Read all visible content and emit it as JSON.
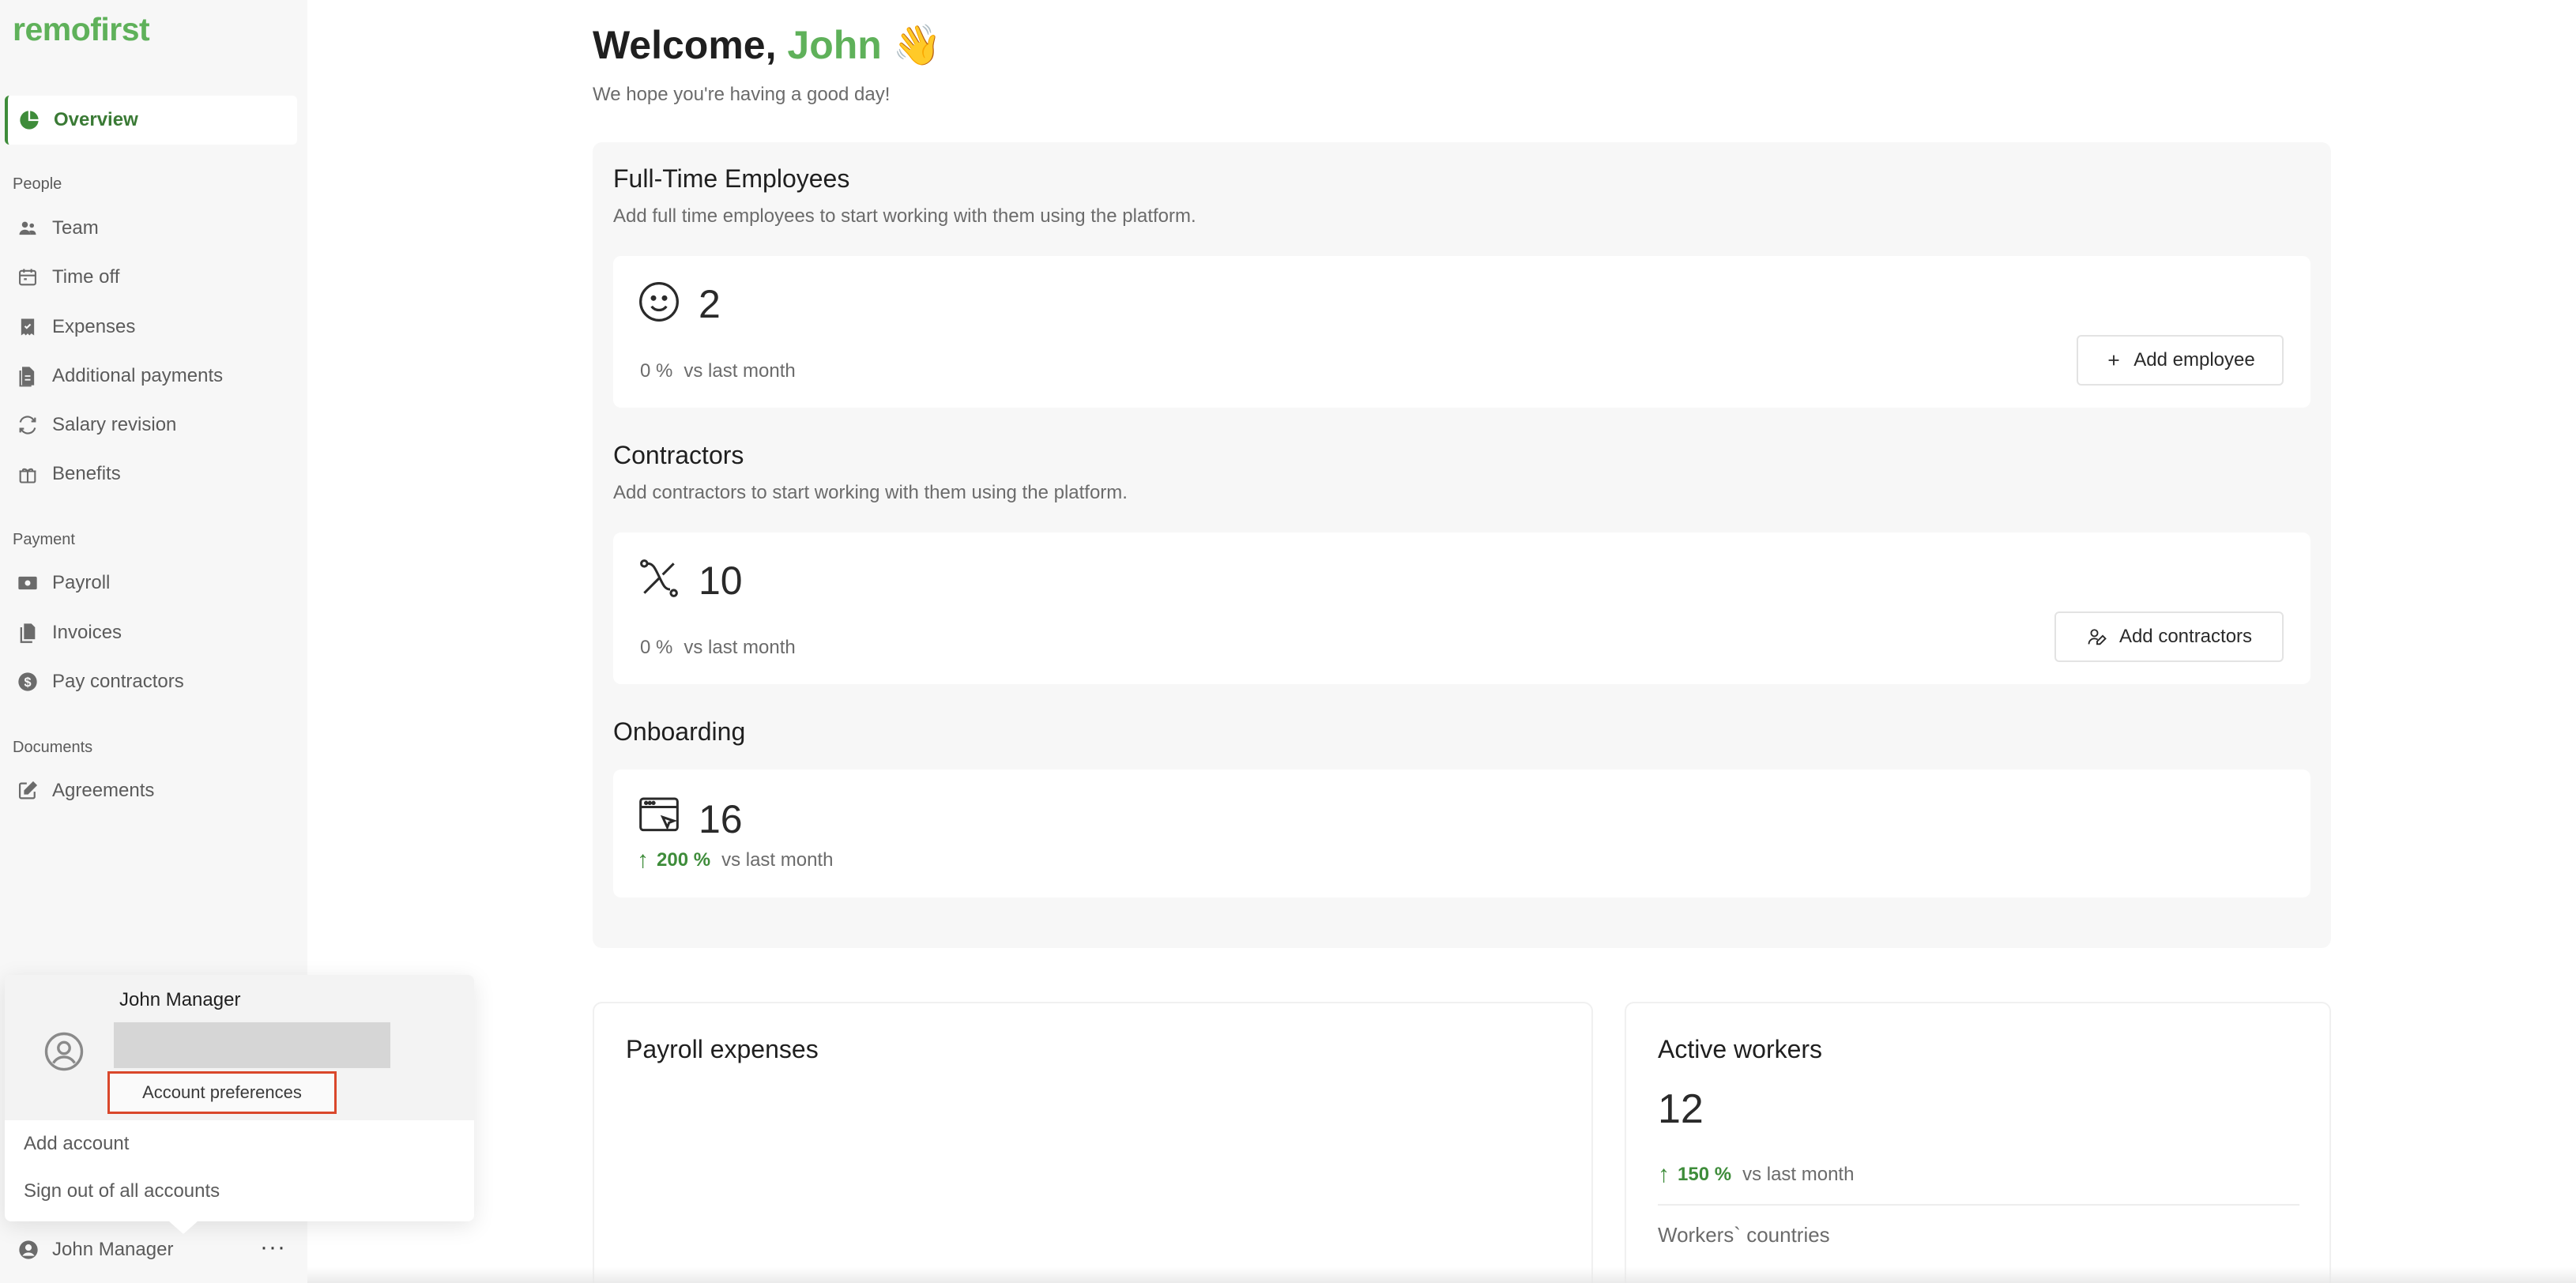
{
  "app": {
    "logo_text": "remofirst",
    "brand_color": "#5fb15a",
    "active_color": "#3e8c3a"
  },
  "sidebar": {
    "overview": {
      "label": "Overview",
      "icon": "pie-chart-icon"
    },
    "sections": [
      {
        "label": "People"
      },
      {
        "label": "Payment"
      },
      {
        "label": "Documents"
      }
    ],
    "people_items": [
      {
        "label": "Team",
        "icon": "team-icon"
      },
      {
        "label": "Time off",
        "icon": "calendar-icon"
      },
      {
        "label": "Expenses",
        "icon": "receipt-icon"
      },
      {
        "label": "Additional payments",
        "icon": "payments-icon"
      },
      {
        "label": "Salary revision",
        "icon": "refresh-icon"
      },
      {
        "label": "Benefits",
        "icon": "gift-icon"
      }
    ],
    "payment_items": [
      {
        "label": "Payroll",
        "icon": "money-icon"
      },
      {
        "label": "Invoices",
        "icon": "files-icon"
      },
      {
        "label": "Pay contractors",
        "icon": "dollar-circle-icon"
      }
    ],
    "document_items": [
      {
        "label": "Agreements",
        "icon": "edit-icon"
      }
    ],
    "footer": {
      "user_name": "John Manager",
      "more_label": "···"
    }
  },
  "account_popup": {
    "name": "John Manager",
    "preferences_label": "Account preferences",
    "add_account_label": "Add account",
    "sign_out_label": "Sign out of all accounts"
  },
  "main": {
    "welcome_prefix": "Welcome,",
    "welcome_name": "John",
    "welcome_emoji": "👋",
    "subtitle": "We hope you're having a good day!",
    "full_time": {
      "title": "Full-Time Employees",
      "desc": "Add full time employees to start working with them using the platform.",
      "count": "2",
      "delta_pct": "0 %",
      "delta_label": "vs last month",
      "button_label": "Add employee"
    },
    "contractors": {
      "title": "Contractors",
      "desc": "Add contractors to start working with them using the platform.",
      "count": "10",
      "delta_pct": "0 %",
      "delta_label": "vs last month",
      "button_label": "Add contractors"
    },
    "onboarding": {
      "title": "Onboarding",
      "count": "16",
      "delta_pct": "200 %",
      "delta_label": "vs last month"
    },
    "payroll_expenses": {
      "title": "Payroll expenses"
    },
    "active_workers": {
      "title": "Active workers",
      "count": "12",
      "delta_pct": "150 %",
      "delta_label": "vs last month",
      "countries_label": "Workers` countries"
    }
  }
}
